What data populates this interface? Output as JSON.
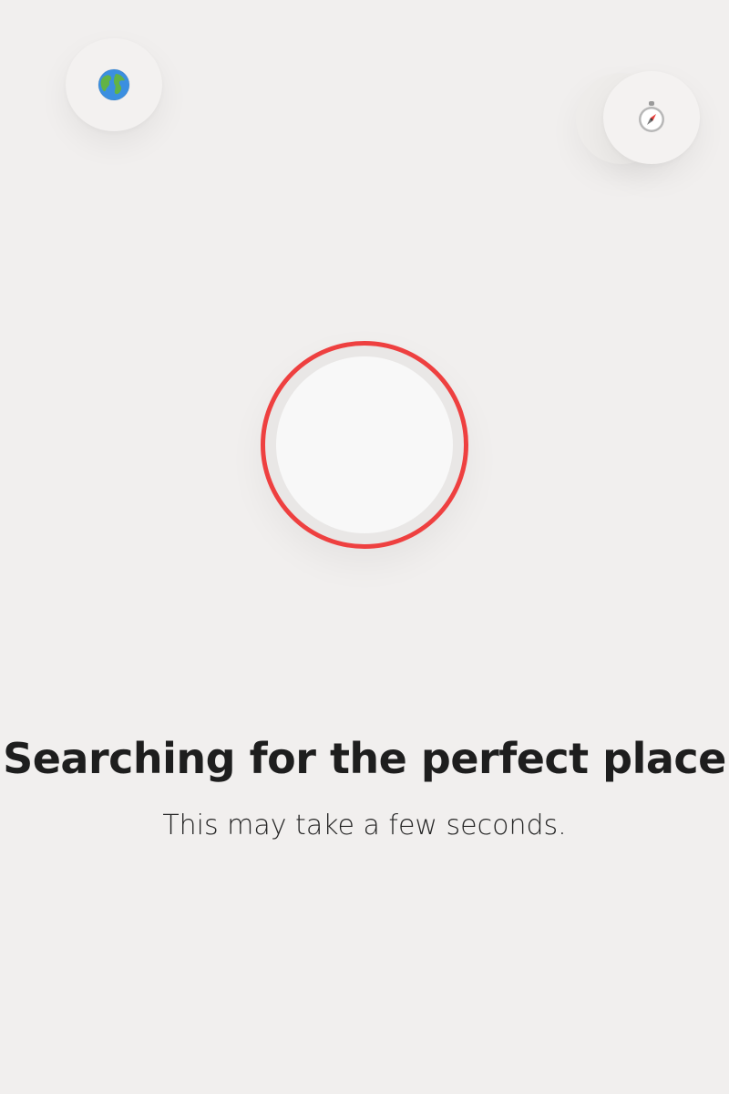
{
  "icons": {
    "top_left": "globe-americas-icon",
    "top_right": "compass-icon"
  },
  "colors": {
    "background": "#f1efee",
    "accent_ring": "#ee4040",
    "loader_core": "#f8f8f8",
    "text": "#1e1e1e"
  },
  "status": {
    "title": "Searching for the perfect place",
    "subtitle": "This may take a few seconds."
  }
}
